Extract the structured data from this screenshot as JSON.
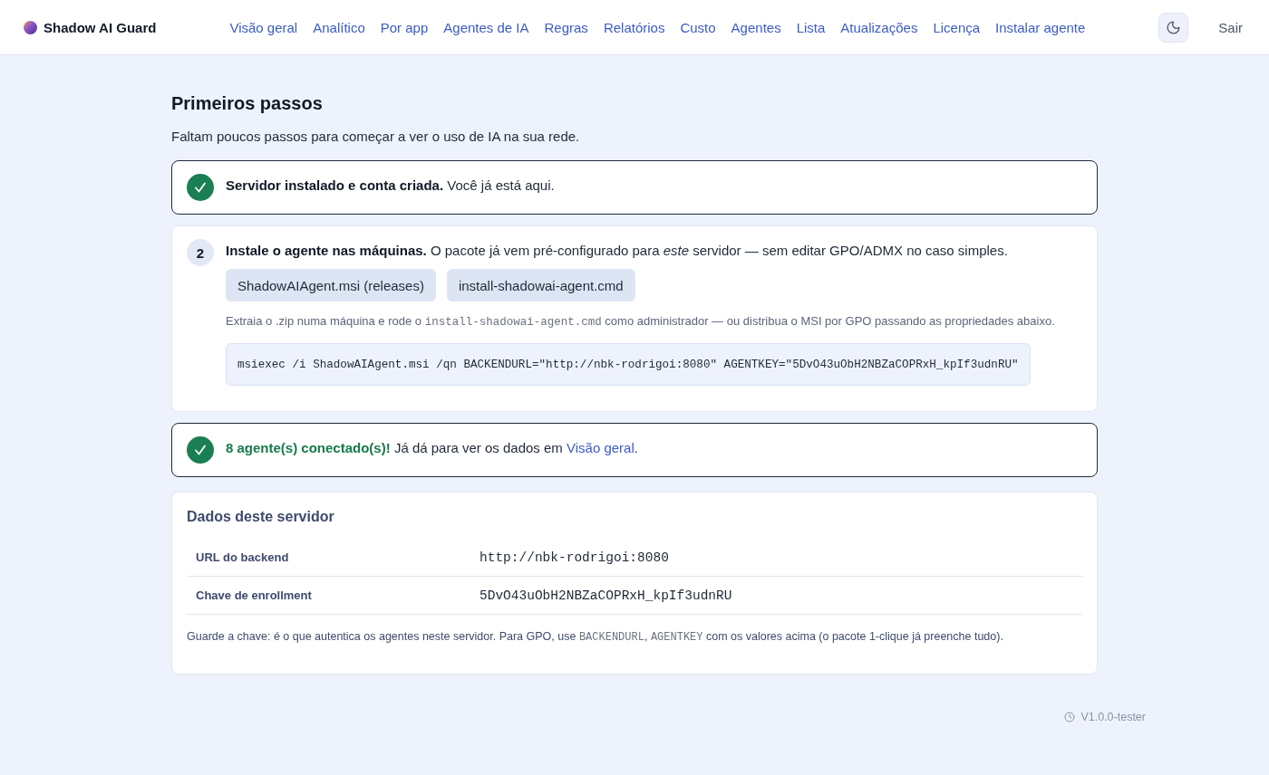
{
  "header": {
    "brand": "Shadow AI Guard",
    "nav": [
      "Visão geral",
      "Analítico",
      "Por app",
      "Agentes de IA",
      "Regras",
      "Relatórios",
      "Custo",
      "Agentes",
      "Lista",
      "Atualizações",
      "Licença",
      "Instalar agente"
    ],
    "logout": "Sair"
  },
  "page": {
    "title": "Primeiros passos",
    "subtitle": "Faltam poucos passos para começar a ver o uso de IA na sua rede."
  },
  "steps": [
    {
      "done": true,
      "highlight": false,
      "lead": "Servidor instalado e conta criada.",
      "text": "Você já está aqui."
    },
    {
      "done": false,
      "number": "2",
      "highlight": false,
      "lead": "Instale o agente nas máquinas.",
      "text": "O pacote já vem pré-configurado para *este* servidor — sem editar GPO/ADMX no caso simples.",
      "downloads": [
        "ShadowAIAgent.msi (releases)",
        "install-shadowai-agent.cmd"
      ],
      "note": [
        {
          "kind": "text",
          "text": "Extraia o .zip numa máquina e rode o "
        },
        {
          "kind": "code",
          "text": "install-shadowai-agent.cmd"
        },
        {
          "kind": "text",
          "text": " como administrador — ou distribua o MSI por GPO passando as propriedades abaixo."
        }
      ],
      "command": "msiexec /i ShadowAIAgent.msi /qn BACKENDURL=\"http://nbk-rodrigoi:8080\" AGENTKEY=\"5DvO43uObH2NBZaCOPRxH_kpIf3udnRU\""
    },
    {
      "done": true,
      "highlight": true,
      "lead": "8 agente(s) conectado(s)!",
      "text": "Já dá para ver os dados em",
      "link": "Visão geral",
      "tail": "."
    }
  ],
  "server": {
    "title": "Dados deste servidor",
    "rows": [
      {
        "label": "URL do backend",
        "value": "http://nbk-rodrigoi:8080"
      },
      {
        "label": "Chave de enrollment",
        "value": "5DvO43uObH2NBZaCOPRxH_kpIf3udnRU"
      }
    ],
    "note": [
      {
        "kind": "text",
        "text": "Guarde a chave: é o que autentica os agentes neste servidor. Para GPO, use "
      },
      {
        "kind": "code",
        "text": "BACKENDURL"
      },
      {
        "kind": "text",
        "text": ", "
      },
      {
        "kind": "code",
        "text": "AGENTKEY"
      },
      {
        "kind": "text",
        "text": " com os valores acima (o pacote 1-clique já preenche tudo)."
      }
    ]
  },
  "footer": {
    "version": "V1.0.0-tester"
  }
}
